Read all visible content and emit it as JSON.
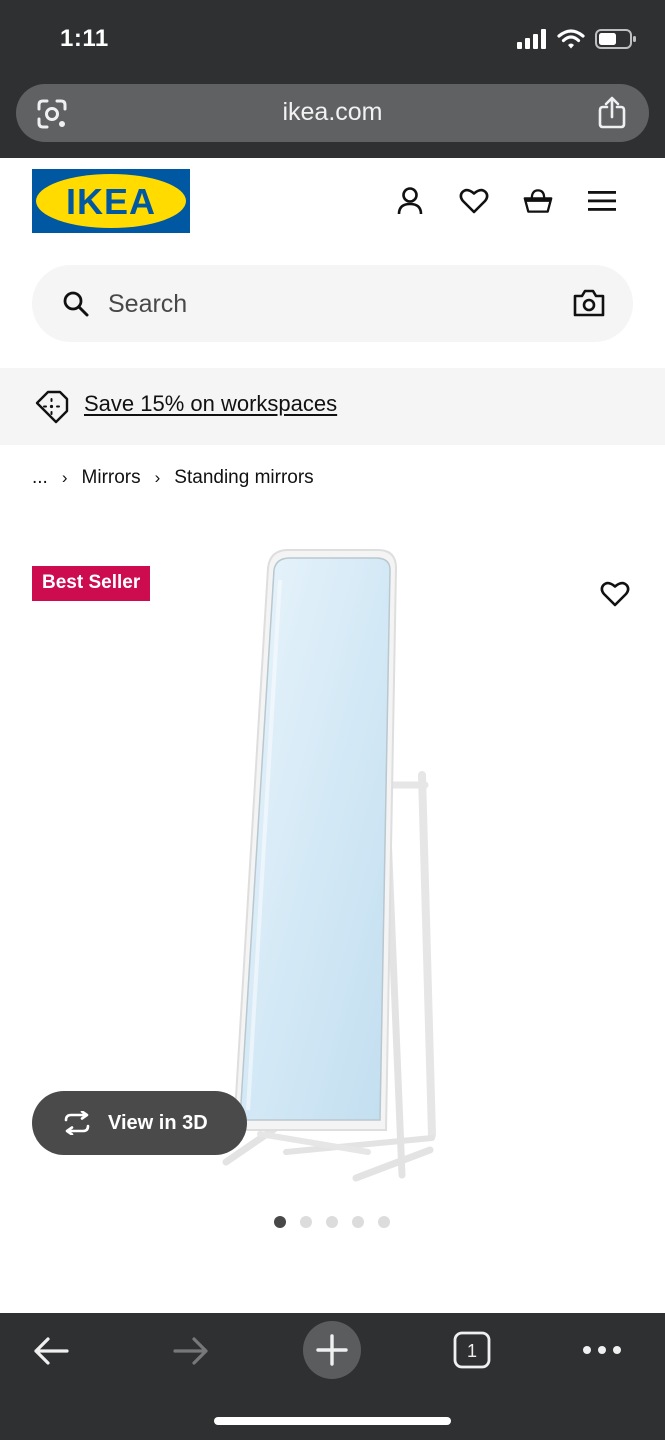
{
  "status_bar": {
    "time": "1:11"
  },
  "browser": {
    "url": "ikea.com"
  },
  "brand": {
    "logo_text": "IKEA",
    "colors": {
      "blue": "#0058a3",
      "yellow": "#ffdb00"
    }
  },
  "header": {
    "icons": [
      "account-icon",
      "heart-icon",
      "cart-icon",
      "menu-icon"
    ]
  },
  "search": {
    "placeholder": "Search"
  },
  "promo": {
    "text": "Save 15% on workspaces"
  },
  "breadcrumb": {
    "ellipsis": "...",
    "items": [
      "Mirrors",
      "Standing mirrors"
    ]
  },
  "product": {
    "badge": "Best Seller",
    "badge_color": "#cc0c4f",
    "view3d_label": "View in 3D",
    "image_count": 5,
    "active_image": 1
  },
  "toolbar": {
    "tab_count": "1"
  }
}
